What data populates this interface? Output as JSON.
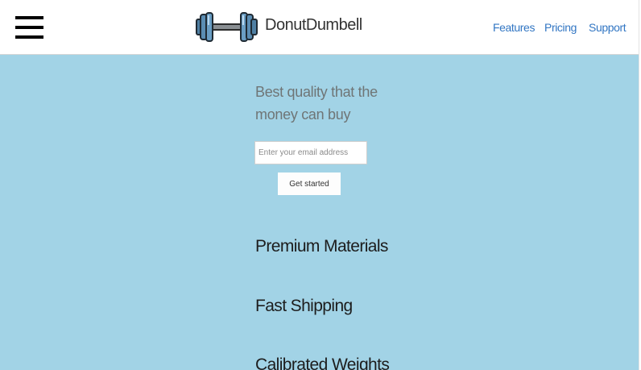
{
  "header": {
    "brand": "DonutDumbell",
    "logo_icon": "dumbbell-icon",
    "menu_icon": "hamburger-menu-icon",
    "nav": [
      {
        "label": "Features"
      },
      {
        "label": "Pricing"
      },
      {
        "label": "Support"
      }
    ]
  },
  "hero": {
    "tagline": "Best quality that the money can buy",
    "email_placeholder": "Enter your email address",
    "email_value": "",
    "cta_label": "Get started"
  },
  "features": [
    {
      "title": "Premium Materials"
    },
    {
      "title": "Fast Shipping"
    },
    {
      "title": "Calibrated Weights"
    }
  ],
  "colors": {
    "background": "#a2d3e6",
    "header_bg": "#ffffff",
    "nav_link": "#3276c3",
    "tagline": "#6f7576",
    "dumbbell_plate": "#4f7fa3",
    "dumbbell_bar": "#8a8f93"
  }
}
